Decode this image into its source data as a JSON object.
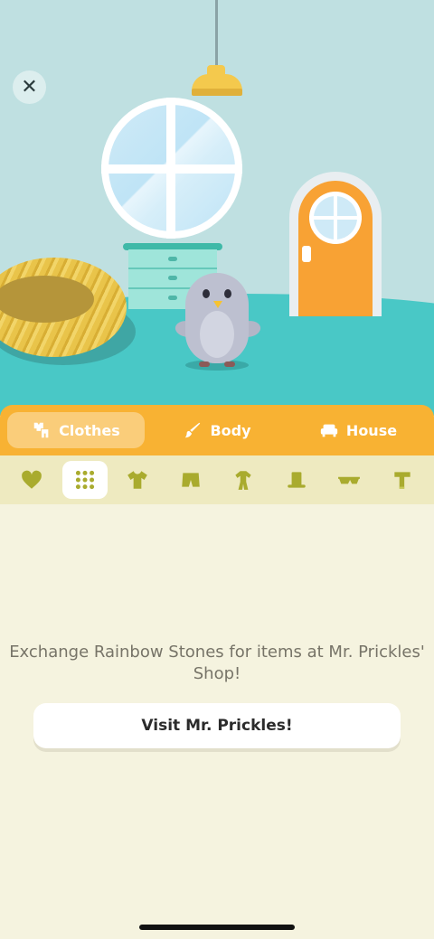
{
  "top_bar": {
    "close_icon": "close-icon",
    "close_glyph": "✕"
  },
  "tabs": [
    {
      "label": "Clothes",
      "icon": "clothes-icon",
      "active": true
    },
    {
      "label": "Body",
      "icon": "brush-icon",
      "active": false
    },
    {
      "label": "House",
      "icon": "sofa-icon",
      "active": false
    }
  ],
  "categories": [
    {
      "icon": "heart-icon",
      "active": false
    },
    {
      "icon": "grid-icon",
      "active": true
    },
    {
      "icon": "shirt-icon",
      "active": false
    },
    {
      "icon": "shorts-icon",
      "active": false
    },
    {
      "icon": "onesie-icon",
      "active": false
    },
    {
      "icon": "top-hat-icon",
      "active": false
    },
    {
      "icon": "sunglasses-icon",
      "active": false
    },
    {
      "icon": "scarf-icon",
      "active": false
    }
  ],
  "content": {
    "message": "Exchange Rainbow Stones for items at Mr. Prickles' Shop!",
    "button_label": "Visit Mr. Prickles!"
  },
  "colors": {
    "scene_wall": "#BFE0E1",
    "floor": "#49C8C6",
    "tab_bar": "#F8B233",
    "category_bar": "#EEEAC0",
    "category_icon": "#A9AB2E",
    "content_bg": "#F5F3DF",
    "door": "#F8A234"
  }
}
